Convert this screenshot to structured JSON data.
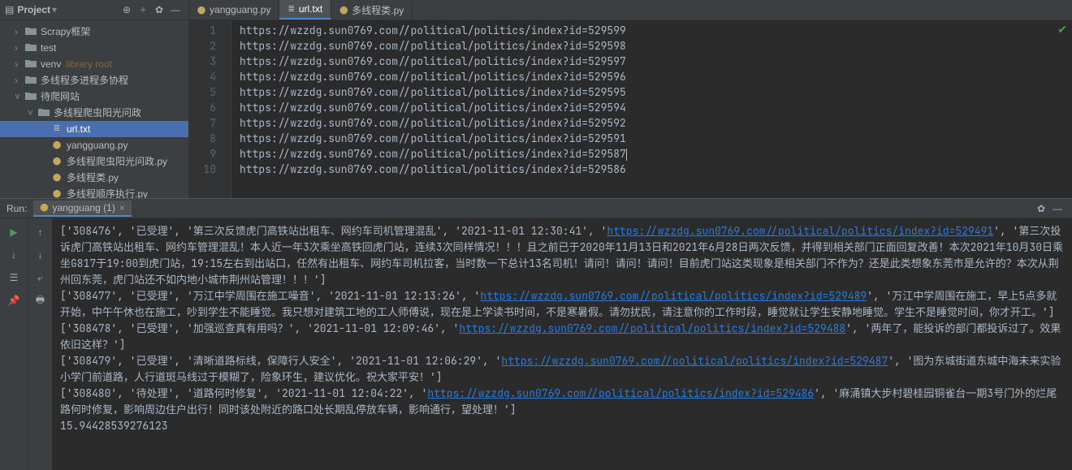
{
  "sidebar": {
    "title": "Project",
    "items": [
      {
        "label": "Scrapy框架",
        "depth": 1,
        "open": false,
        "type": "folder"
      },
      {
        "label": "test",
        "depth": 1,
        "open": false,
        "type": "folder"
      },
      {
        "label": "venv",
        "depth": 1,
        "open": false,
        "type": "folder",
        "hint": "library root"
      },
      {
        "label": "多线程多进程多协程",
        "depth": 1,
        "open": false,
        "type": "folder"
      },
      {
        "label": "待爬网站",
        "depth": 1,
        "open": true,
        "type": "folder"
      },
      {
        "label": "多线程爬虫阳光问政",
        "depth": 2,
        "open": true,
        "type": "folder"
      },
      {
        "label": "url.txt",
        "depth": 3,
        "type": "txt",
        "selected": true
      },
      {
        "label": "yangguang.py",
        "depth": 3,
        "type": "py"
      },
      {
        "label": "多线程爬虫阳光问政.py",
        "depth": 3,
        "type": "py"
      },
      {
        "label": "多线程类.py",
        "depth": 3,
        "type": "py"
      },
      {
        "label": "多线程顺序执行.py",
        "depth": 3,
        "type": "py"
      }
    ]
  },
  "tabs": [
    {
      "label": "yangguang.py",
      "type": "py",
      "active": false
    },
    {
      "label": "url.txt",
      "type": "txt",
      "active": true
    },
    {
      "label": "多线程类.py",
      "type": "py",
      "active": false
    }
  ],
  "lines": [
    "https://wzzdg.sun0769.com//political/politics/index?id=529599",
    "https://wzzdg.sun0769.com//political/politics/index?id=529598",
    "https://wzzdg.sun0769.com//political/politics/index?id=529597",
    "https://wzzdg.sun0769.com//political/politics/index?id=529596",
    "https://wzzdg.sun0769.com//political/politics/index?id=529595",
    "https://wzzdg.sun0769.com//political/politics/index?id=529594",
    "https://wzzdg.sun0769.com//political/politics/index?id=529592",
    "https://wzzdg.sun0769.com//political/politics/index?id=529591",
    "https://wzzdg.sun0769.com//political/politics/index?id=529587",
    "https://wzzdg.sun0769.com//political/politics/index?id=529586"
  ],
  "caret_line": 9,
  "run": {
    "label": "Run:",
    "tab": "yangguang (1)",
    "rows": [
      {
        "pre": "['308476', '已受理', '第三次反馈虎门高铁站出租车、网约车司机管理混乱', '2021-11-01 12:30:41', '",
        "link": "https://wzzdg.sun0769.com//political/politics/index?id=529491",
        "post": "', '第三次投诉虎门高铁站出租车、网约车管理混乱！本人近一年3次乘坐高铁回虎门站，连续3次同样情况！！！且之前已于2020年11月13日和2021年6月28日两次反馈，并得到相关部门正面回复改善！本次2021年10月30日乘坐G817于19:00到虎门站，19:15左右到出站口，任然有出租车、网约车司机拉客，当时数一下总计13名司机！请问！请问！请问！目前虎门站这类现象是相关部门不作为？还是此类想象东莞市是允许的？本次从荆州回东莞，虎门站还不如内地小城市荆州站管理！！！']"
      },
      {
        "pre": "['308477', '已受理', '万江中学周围在施工噪音', '2021-11-01 12:13:26', '",
        "link": "https://wzzdg.sun0769.com//political/politics/index?id=529489",
        "post": "', '万江中学周围在施工，早上5点多就开始，中午午休也在施工，吵到学生不能睡觉。我只想对建筑工地的工人师傅说，现在是上学读书时间，不是寒暑假。请勿扰民，请注意你的工作时段，睡觉就让学生安静地睡觉。学生不是睡觉时间，你才开工。']"
      },
      {
        "pre": "['308478', '已受理', '加强巡查真有用吗？', '2021-11-01 12:09:46', '",
        "link": "https://wzzdg.sun0769.com//political/politics/index?id=529488",
        "post": "', '两年了，能投诉的部门都投诉过了。效果依旧这样？']"
      },
      {
        "pre": "['308479', '已受理', '清晰道路标线，保障行人安全', '2021-11-01 12:06:29', '",
        "link": "https://wzzdg.sun0769.com//political/politics/index?id=529487",
        "post": "', '图为东城街道东城中海未来实验小学门前道路，人行道斑马线过于模糊了，险象环生，建议优化。祝大家平安！']"
      },
      {
        "pre": "['308480', '待处理', '道路何时修复', '2021-11-01 12:04:22', '",
        "link": "https://wzzdg.sun0769.com//political/politics/index?id=529486",
        "post": "', '麻涌镇大步村碧桂园铜雀台一期3号门外的烂尾路何时修复，影响周边住户出行！同时该处附近的路口处长期乱停放车辆，影响通行，望处理！']"
      }
    ],
    "timing": "15.94428539276123"
  }
}
